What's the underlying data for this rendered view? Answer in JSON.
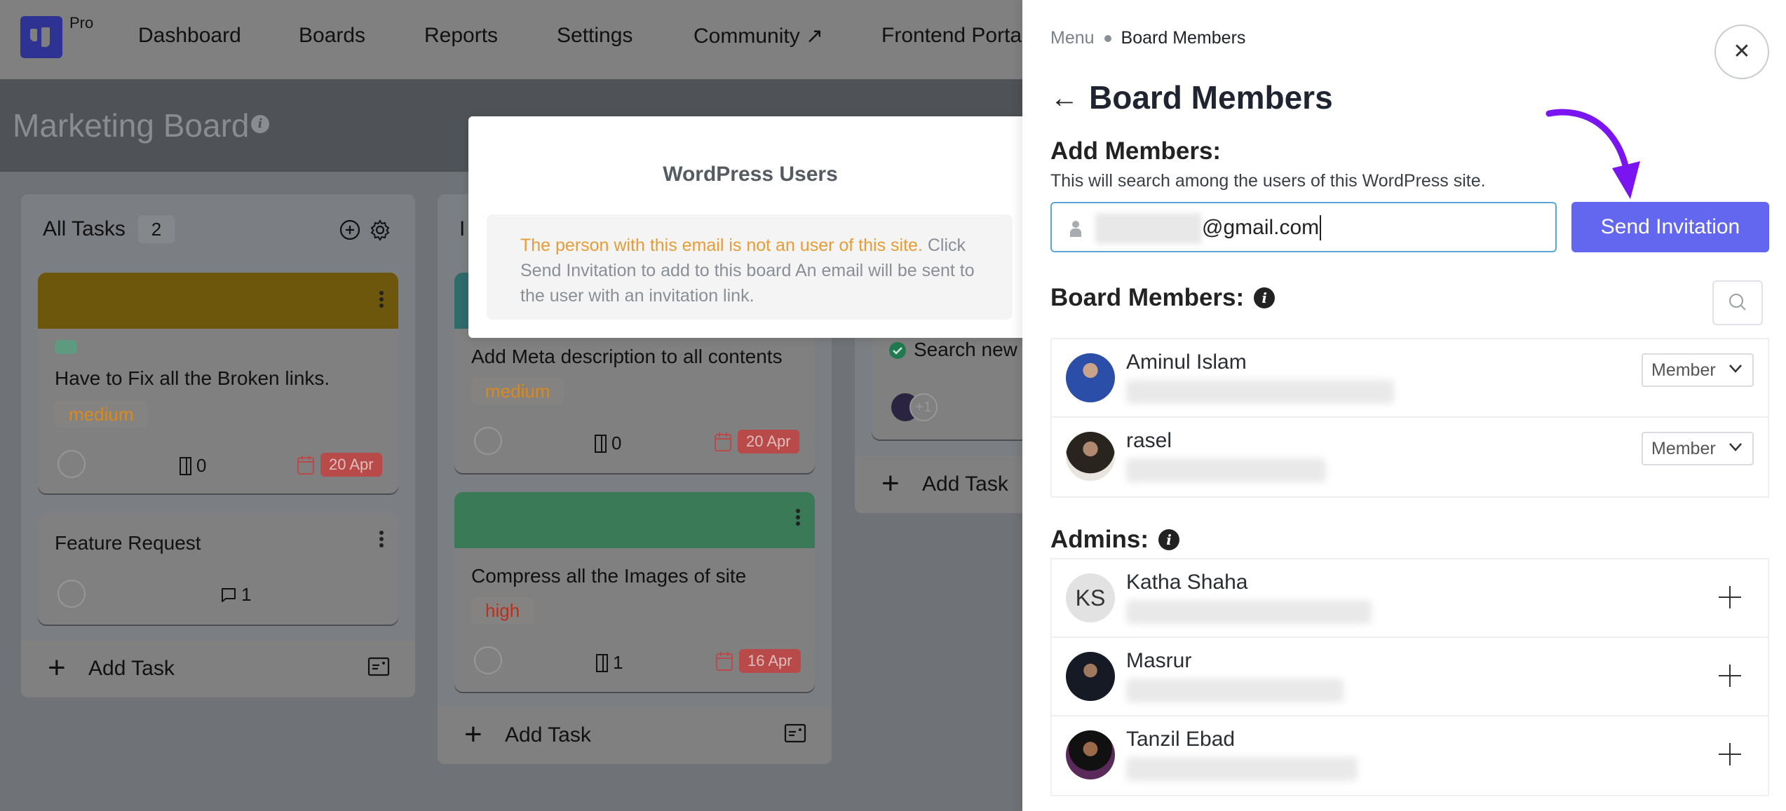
{
  "brand": {
    "badge": "Pro",
    "color": "#2e3292"
  },
  "nav": {
    "items": [
      {
        "label": "Dashboard"
      },
      {
        "label": "Boards"
      },
      {
        "label": "Reports"
      },
      {
        "label": "Settings"
      },
      {
        "label": "Community ↗"
      },
      {
        "label": "Frontend Portal"
      }
    ]
  },
  "board": {
    "title": "Marketing Board",
    "info_icon": "info-icon"
  },
  "columns": [
    {
      "title": "All Tasks",
      "count": "2",
      "cards": [
        {
          "cover_color": "#6c570c",
          "label_color": "#5e9a80",
          "title": "Have to Fix all the Broken links.",
          "priority": "medium",
          "priority_color": "#d98a1e",
          "attachments": "0",
          "due": "20 Apr"
        },
        {
          "title": "Feature Request",
          "comments": "1"
        }
      ],
      "add_task": "Add Task"
    },
    {
      "title_partial": "I",
      "cards": [
        {
          "cover_color": "#2f6b6b",
          "title": "Add Meta description to all contents",
          "priority": "medium",
          "priority_color": "#d98a1e",
          "attachments": "0",
          "due": "20 Apr"
        },
        {
          "cover_color": "#3a7a56",
          "title": "Compress all the Images of site",
          "priority": "high",
          "priority_color": "#b5321e",
          "attachments": "1",
          "due": "16 Apr"
        }
      ],
      "add_task": "Add Task"
    },
    {
      "cards": [
        {
          "title_partial": "Search new",
          "status": "completed",
          "extra_assignees": "+1"
        }
      ],
      "add_task": "Add Task"
    }
  ],
  "popup": {
    "title": "WordPress Users",
    "warning": "The person with this email is not an user of this site.",
    "message": " Click Send Invitation to add to this board An email will be sent to the user with an invitation link."
  },
  "panel": {
    "breadcrumb": {
      "root": "Menu",
      "current": "Board Members"
    },
    "title": "Board Members",
    "add_members": {
      "heading": "Add Members:",
      "description": "This will search among the users of this WordPress site.",
      "email_value": "@gmail.com",
      "send_label": "Send Invitation",
      "send_color": "#6366ee"
    },
    "board_members": {
      "heading": "Board Members:",
      "members": [
        {
          "name": "Aminul Islam",
          "role": "Member"
        },
        {
          "name": "rasel",
          "role": "Member"
        }
      ]
    },
    "admins": {
      "heading": "Admins:",
      "users": [
        {
          "name": "Katha Shaha",
          "initials": "KS"
        },
        {
          "name": "Masrur"
        },
        {
          "name": "Tanzil Ebad"
        }
      ]
    }
  }
}
